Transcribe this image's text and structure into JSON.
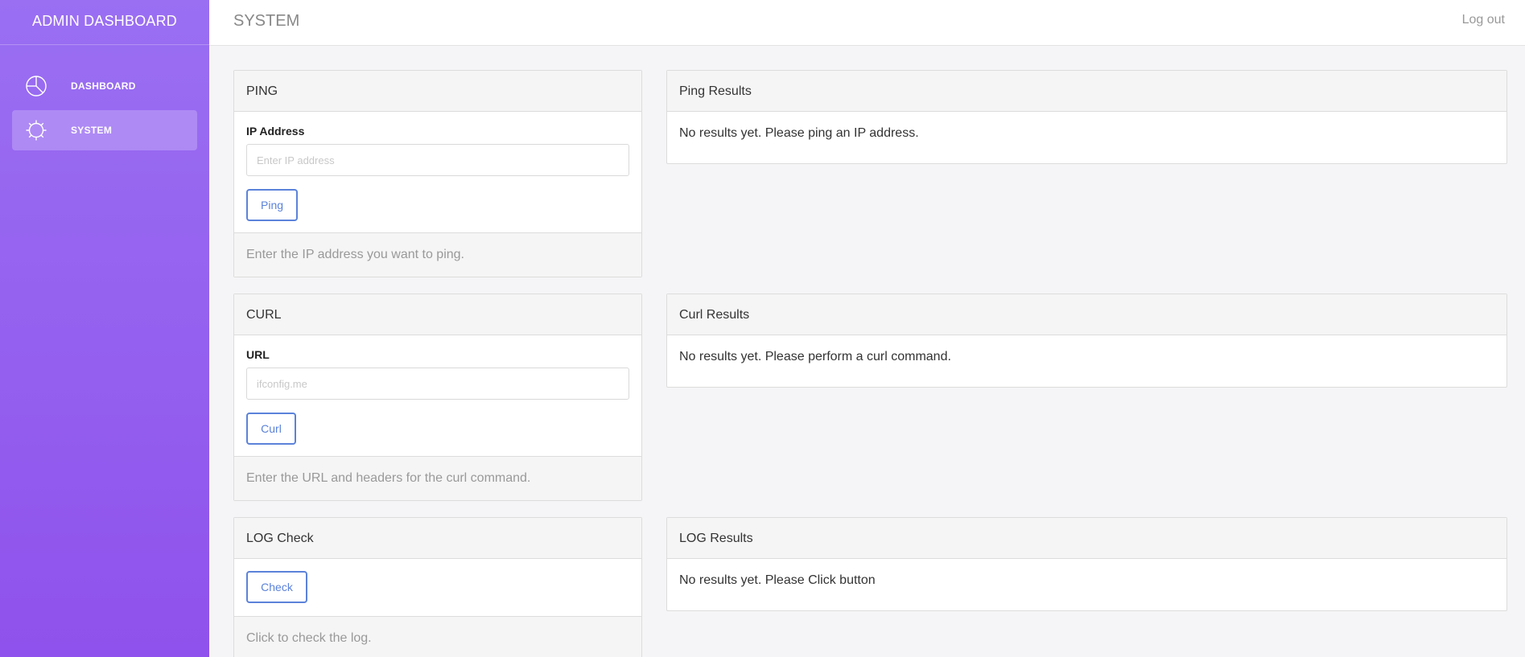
{
  "sidebar": {
    "brand": "ADMIN DASHBOARD",
    "items": [
      {
        "label": "DASHBOARD",
        "icon": "pie-chart-icon"
      },
      {
        "label": "SYSTEM",
        "icon": "gear-icon",
        "active": true
      }
    ]
  },
  "header": {
    "title": "SYSTEM",
    "logout_label": "Log out"
  },
  "ping": {
    "title": "PING",
    "field_label": "IP Address",
    "placeholder": "Enter IP address",
    "value": "",
    "button": "Ping",
    "footer": "Enter the IP address you want to ping."
  },
  "ping_results": {
    "title": "Ping Results",
    "text": "No results yet. Please ping an IP address."
  },
  "curl": {
    "title": "CURL",
    "field_label": "URL",
    "placeholder": "ifconfig.me",
    "value": "",
    "button": "Curl",
    "footer": "Enter the URL and headers for the curl command."
  },
  "curl_results": {
    "title": "Curl Results",
    "text": "No results yet. Please perform a curl command."
  },
  "log": {
    "title": "LOG Check",
    "button": "Check",
    "footer": "Click to check the log."
  },
  "log_results": {
    "title": "LOG Results",
    "text": "No results yet. Please Click button"
  },
  "colors": {
    "sidebar_top": "#9a6ff2",
    "sidebar_bottom": "#8f52ec",
    "accent": "#5b82da"
  }
}
